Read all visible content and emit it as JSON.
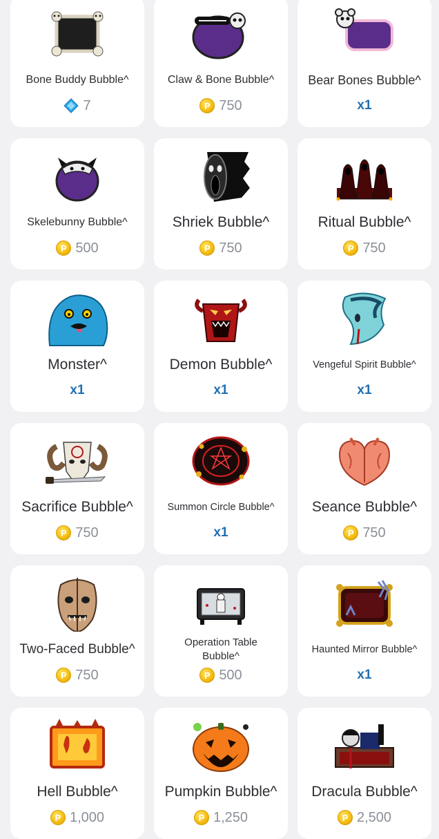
{
  "colors": {
    "background": "#f1f1f3",
    "card": "#ffffff",
    "text": "#2e2e33",
    "price": "#8a8f98",
    "quantity": "#1f6fb2",
    "coin": "#f6bf12",
    "gem": "#2aa7e8"
  },
  "items": [
    {
      "name": "Bone Buddy Bubble^",
      "price": "7",
      "currency": "gem",
      "icon": "bone-frame-icon"
    },
    {
      "name": "Claw & Bone Bubble^",
      "price": "750",
      "currency": "coin",
      "icon": "skeleton-cat-bubble-icon"
    },
    {
      "name": "Bear Bones Bubble^",
      "price": "x1",
      "currency": "quantity",
      "icon": "skeleton-bear-bubble-icon"
    },
    {
      "name": "Skelebunny Bubble^",
      "price": "500",
      "currency": "coin",
      "icon": "skelebunny-icon"
    },
    {
      "name": "Shriek Bubble^",
      "price": "750",
      "currency": "coin",
      "icon": "screaming-ghost-icon"
    },
    {
      "name": "Ritual Bubble^",
      "price": "750",
      "currency": "coin",
      "icon": "hooded-cultists-icon"
    },
    {
      "name": "Monster^",
      "price": "x1",
      "currency": "quantity",
      "icon": "blue-monster-icon"
    },
    {
      "name": "Demon Bubble^",
      "price": "x1",
      "currency": "quantity",
      "icon": "demon-face-icon"
    },
    {
      "name": "Vengeful Spirit Bubble^",
      "price": "x1",
      "currency": "quantity",
      "icon": "vengeful-spirit-icon"
    },
    {
      "name": "Sacrifice Bubble^",
      "price": "750",
      "currency": "coin",
      "icon": "ram-skull-knife-icon"
    },
    {
      "name": "Summon Circle Bubble^",
      "price": "x1",
      "currency": "quantity",
      "icon": "summon-circle-icon"
    },
    {
      "name": "Seance Bubble^",
      "price": "750",
      "currency": "coin",
      "icon": "seance-heart-icon"
    },
    {
      "name": "Two-Faced Bubble^",
      "price": "750",
      "currency": "coin",
      "icon": "two-faced-mask-icon"
    },
    {
      "name": "Operation Table Bubble^",
      "price": "500",
      "currency": "coin",
      "icon": "operation-table-icon"
    },
    {
      "name": "Haunted Mirror Bubble^",
      "price": "x1",
      "currency": "quantity",
      "icon": "haunted-mirror-icon"
    },
    {
      "name": "Hell Bubble^",
      "price": "1,000",
      "currency": "coin",
      "icon": "hell-flames-icon"
    },
    {
      "name": "Pumpkin Bubble^",
      "price": "1,250",
      "currency": "coin",
      "icon": "jack-o-lantern-icon"
    },
    {
      "name": "Dracula Bubble^",
      "price": "2,500",
      "currency": "coin",
      "icon": "dracula-coffin-icon"
    }
  ],
  "coin_symbol": "P"
}
